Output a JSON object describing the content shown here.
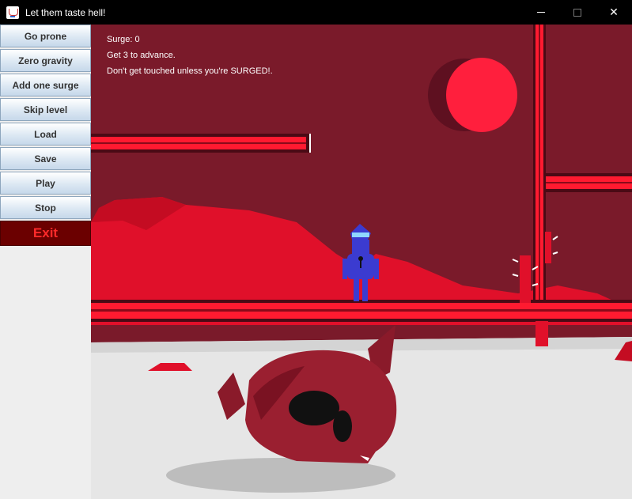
{
  "window": {
    "title": "Let them taste hell!",
    "controls": {
      "minimize": "minimize-icon",
      "maximize": "maximize-icon",
      "close": "✕"
    }
  },
  "sidebar": {
    "buttons": [
      {
        "label": "Go prone"
      },
      {
        "label": "Zero gravity"
      },
      {
        "label": "Add one surge"
      },
      {
        "label": "Skip level"
      },
      {
        "label": "Load"
      },
      {
        "label": "Save"
      },
      {
        "label": "Play"
      },
      {
        "label": "Stop"
      }
    ],
    "exit_label": "Exit"
  },
  "hud": {
    "surge": "Surge: 0",
    "goal": "Get 3 to advance.",
    "warning": "Don't get touched unless you're SURGED!."
  },
  "colors": {
    "sky": "#7a1a2a",
    "moon": "#ff1f3d",
    "platform": "#e0102a",
    "ground": "#e6e6e6",
    "player": "#3b3bd0",
    "exit_text": "#ff2a2a"
  }
}
